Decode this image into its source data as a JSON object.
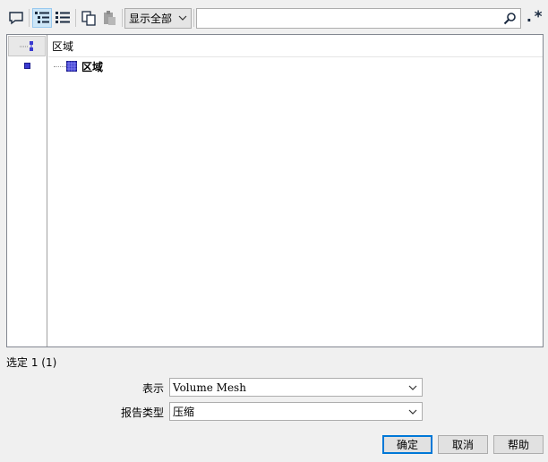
{
  "toolbar": {
    "buttons": [
      {
        "name": "comment-icon",
        "active": false
      },
      {
        "name": "tree-view-icon",
        "active": true
      },
      {
        "name": "list-view-icon",
        "active": false
      },
      {
        "name": "copy-icon",
        "active": false
      },
      {
        "name": "paste-icon",
        "active": false
      }
    ],
    "filter_value": "显示全部",
    "search_value": "",
    "regex_label": ".*"
  },
  "tree": {
    "header": "区域",
    "items": [
      {
        "label": "区域",
        "icon": "region-icon"
      }
    ]
  },
  "status": "选定 1 (1)",
  "form": {
    "representation_label": "表示",
    "representation_value": "Volume Mesh",
    "report_type_label": "报告类型",
    "report_type_value": "压缩"
  },
  "buttons": {
    "ok": "确定",
    "cancel": "取消",
    "help": "帮助"
  },
  "colors": {
    "accent": "#0078d7",
    "toolbar_active": "#cde6f7",
    "tree_icon": "#3a3ad0"
  }
}
